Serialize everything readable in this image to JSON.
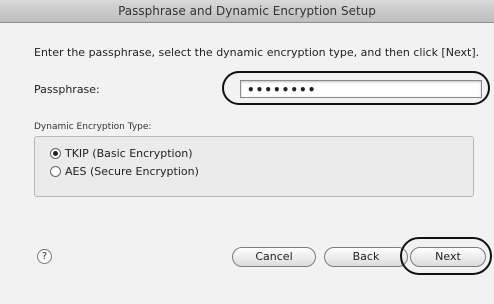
{
  "window": {
    "title": "Passphrase and Dynamic Encryption Setup"
  },
  "instruction": "Enter the passphrase, select the dynamic encryption type, and then click [Next].",
  "passphrase": {
    "label": "Passphrase:",
    "value": "••••••••"
  },
  "encryption": {
    "group_label": "Dynamic Encryption Type:",
    "options": [
      {
        "label": "TKIP (Basic Encryption)",
        "selected": true
      },
      {
        "label": "AES (Secure Encryption)",
        "selected": false
      }
    ]
  },
  "footer": {
    "help_glyph": "?",
    "cancel_label": "Cancel",
    "back_label": "Back",
    "next_label": "Next"
  }
}
